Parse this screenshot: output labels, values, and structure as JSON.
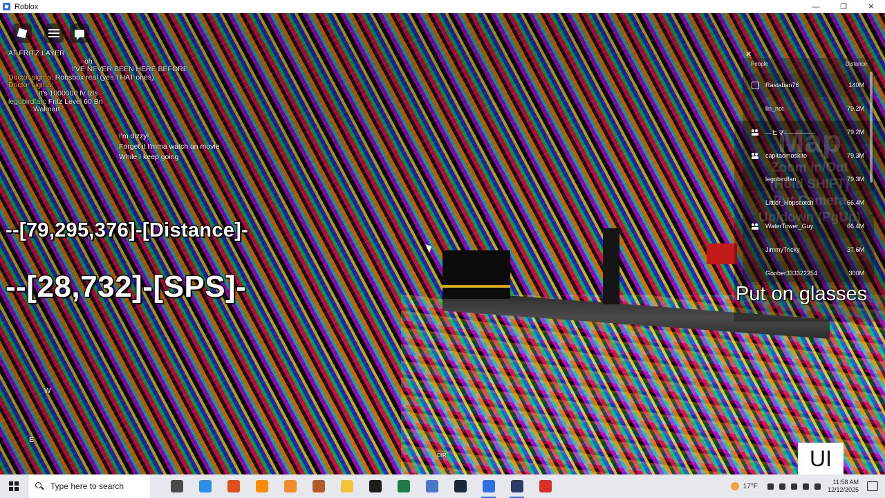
{
  "window": {
    "title": "Roblox",
    "controls": [
      "—",
      "❐",
      "✕"
    ]
  },
  "chat": [
    {
      "name": "",
      "nameClass": "",
      "text": "AT FRITZ LAYER"
    },
    {
      "name": "",
      "nameClass": "",
      "text": "oh"
    },
    {
      "name": "",
      "nameClass": "pink",
      "text": "I'VE NEVER BEEN HERE BEFORE"
    },
    {
      "name": "Doctor sigma:",
      "nameClass": "",
      "text": "Robsbox real (yes THAT ones)"
    },
    {
      "name": "Doctor sigma:",
      "nameClass": "",
      "text": ""
    },
    {
      "name": "",
      "nameClass": "cyan",
      "text": "it's 1000000 fv lzls"
    },
    {
      "name": "legobirdfan:",
      "nameClass": "green",
      "text": "Fritz Level 60 Bn"
    },
    {
      "name": "",
      "nameClass": "",
      "text": "Walmart"
    }
  ],
  "bubble": [
    "I'm dizzy!",
    "Forget it I'mma watch an movie",
    "While I keep going"
  ],
  "stats": {
    "distance": "--[79,295,376]-[Distance]-",
    "sps": "--[28,732]-[SPS]-"
  },
  "playerlist": {
    "close": "✕",
    "header_left": "People",
    "header_right": "Distance",
    "players": [
      {
        "icon": "premium",
        "name": "Rastaban76",
        "distance": "140M"
      },
      {
        "icon": "none",
        "name": "lin_not",
        "distance": "79.2M"
      },
      {
        "icon": "friend",
        "name": "—ヒマ—————",
        "distance": "79.2M"
      },
      {
        "icon": "friend",
        "name": "capitaomoskito",
        "distance": "79.3M"
      },
      {
        "icon": "none",
        "name": "legobirdfan",
        "distance": "79.3M"
      },
      {
        "icon": "none",
        "name": "Littler_Hopscotch",
        "distance": "66.4M"
      },
      {
        "icon": "friend",
        "name": "WaterTower_Guy",
        "distance": "66.4M"
      },
      {
        "icon": "none",
        "name": "JimmyTricky",
        "distance": "37.6M"
      },
      {
        "icon": "none",
        "name": "Goober333322254",
        "distance": "300M"
      }
    ]
  },
  "map_sign": {
    "title": "Map",
    "line1": "Zoom in/Out",
    "line2": "(Hold SHIFT)",
    "line3": "Put Camera",
    "line4": "Up/down (PgUp)"
  },
  "glasses_text": "Put on glasses",
  "key_hints": {
    "w": "W",
    "e": "E",
    "dir": "DIR"
  },
  "ui_toggle": "UI",
  "taskbar": {
    "search_placeholder": "Type here to search",
    "apps": [
      "task-view",
      "edge",
      "brave",
      "firefox",
      "blender",
      "roblox-studio",
      "file-explorer",
      "terminal",
      "excel",
      "notepad",
      "steam",
      "roblox",
      "roblox-player",
      "chrome"
    ],
    "app_colors": [
      "#4a4a4a",
      "#2f8de4",
      "#e14e1e",
      "#ff8a00",
      "#f28c28",
      "#b35b2a",
      "#f3c43a",
      "#1d1d1d",
      "#1e7b45",
      "#4a78c7",
      "#1b2838",
      "#2f6fe0",
      "#2a3b68",
      "#d93025"
    ],
    "weather": "17°F",
    "time": "11:58 AM",
    "date": "12/12/2025"
  },
  "accent": "#2f6fe0"
}
